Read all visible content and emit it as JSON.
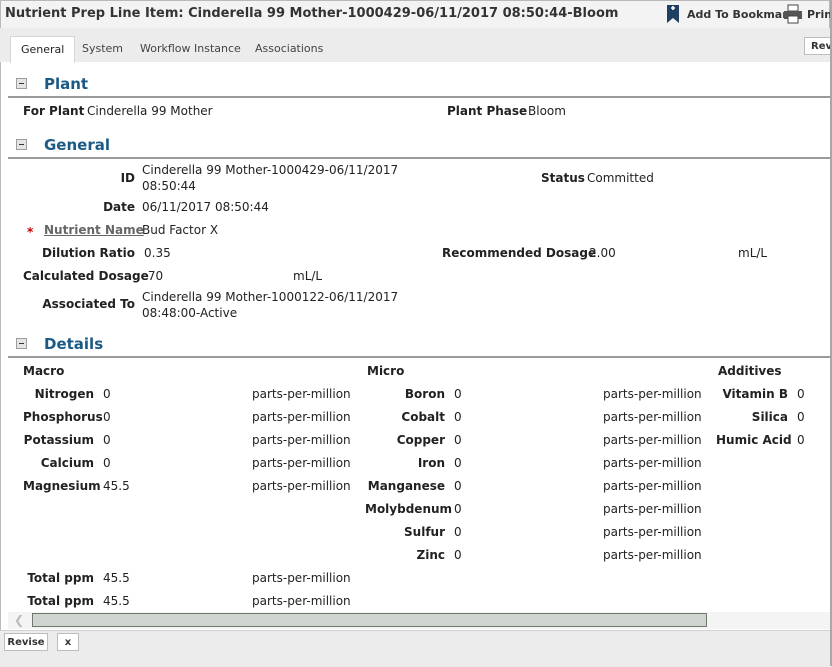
{
  "window": {
    "title": "Nutrient Prep Line Item: Cinderella 99 Mother-1000429-06/11/2017 08:50:44-Bloom"
  },
  "toolbar": {
    "bookmark_label": "Add To Bookmarks",
    "print_label": "Print",
    "bookmark_icon": "bookmark-add-icon",
    "print_icon": "printer-icon"
  },
  "tabs": [
    {
      "label": "General",
      "active": true
    },
    {
      "label": "System"
    },
    {
      "label": "Workflow Instance"
    },
    {
      "label": "Associations"
    }
  ],
  "top_action": {
    "revise_label": "Revi"
  },
  "sections": {
    "plant": {
      "title": "Plant"
    },
    "general": {
      "title": "General"
    },
    "details": {
      "title": "Details"
    }
  },
  "plant": {
    "for_plant_label": "For Plant",
    "for_plant_value": "Cinderella 99 Mother",
    "phase_label": "Plant Phase",
    "phase_value": "Bloom"
  },
  "general": {
    "id_label": "ID",
    "id_value_line1": "Cinderella 99 Mother-1000429-06/11/2017",
    "id_value_line2": "08:50:44",
    "status_label": "Status",
    "status_value": "Committed",
    "date_label": "Date",
    "date_value": "06/11/2017 08:50:44",
    "required_mark": "*",
    "nutrient_label": "Nutrient Name",
    "nutrient_value": "Bud Factor X",
    "dilution_label": "Dilution Ratio",
    "dilution_value": "0.35",
    "recommended_label": "Recommended Dosage",
    "recommended_value": "2.00",
    "recommended_unit": "mL/L",
    "calculated_label": "Calculated Dosage",
    "calculated_value": ".70",
    "calculated_unit": "mL/L",
    "associated_label": "Associated To",
    "associated_value_line1": "Cinderella 99 Mother-1000122-06/11/2017",
    "associated_value_line2": "08:48:00-Active"
  },
  "details": {
    "macro_header": "Macro",
    "micro_header": "Micro",
    "additives_header": "Additives",
    "unit": "parts-per-million",
    "macro": [
      {
        "label": "Nitrogen",
        "value": "0"
      },
      {
        "label": "Phosphorus",
        "value": "0"
      },
      {
        "label": "Potassium",
        "value": "0"
      },
      {
        "label": "Calcium",
        "value": "0"
      },
      {
        "label": "Magnesium",
        "value": "45.5"
      }
    ],
    "micro": [
      {
        "label": "Boron",
        "value": "0"
      },
      {
        "label": "Cobalt",
        "value": "0"
      },
      {
        "label": "Copper",
        "value": "0"
      },
      {
        "label": "Iron",
        "value": "0"
      },
      {
        "label": "Manganese",
        "value": "0"
      },
      {
        "label": "Molybdenum",
        "value": "0"
      },
      {
        "label": "Sulfur",
        "value": "0"
      },
      {
        "label": "Zinc",
        "value": "0"
      }
    ],
    "additives": [
      {
        "label": "Vitamin B",
        "value": "0"
      },
      {
        "label": "Silica",
        "value": "0"
      },
      {
        "label": "Humic Acid",
        "value": "0"
      }
    ],
    "totals": [
      {
        "label": "Total ppm",
        "value": "45.5"
      },
      {
        "label": "Total ppm",
        "value": "45.5"
      }
    ]
  },
  "footer": {
    "revise_label": "Revise",
    "close_label": "x"
  },
  "colors": {
    "section_title": "#1c5a86",
    "required": "#c00000",
    "scroll_thumb": "#cfd4d0"
  }
}
